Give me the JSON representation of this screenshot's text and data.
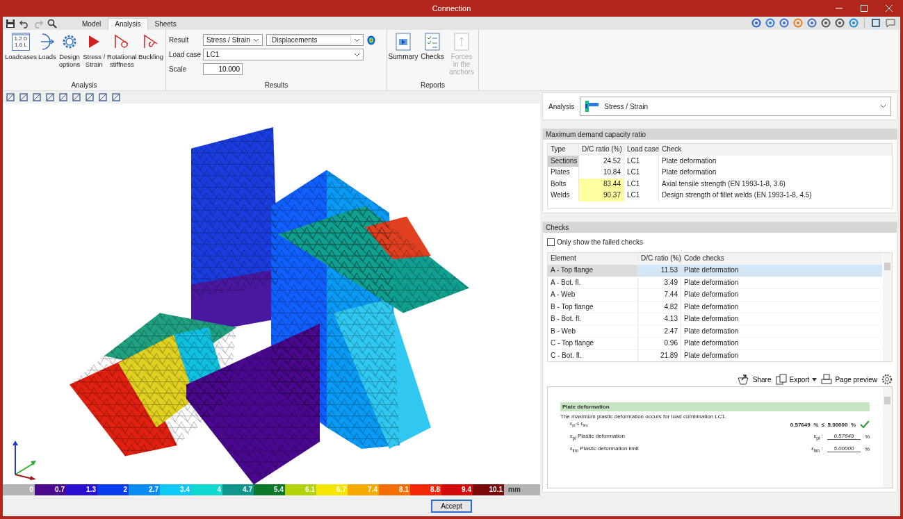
{
  "window": {
    "title": "Connection"
  },
  "tabs": [
    {
      "label": "Model",
      "selected": false
    },
    {
      "label": "Analysis",
      "selected": true
    },
    {
      "label": "Sheets",
      "selected": false
    }
  ],
  "ribbon": {
    "groups": [
      {
        "label": "Analysis",
        "buttons": [
          {
            "kind": "loadcases",
            "label": "Loadcases",
            "disabled": false,
            "icon_text": [
              "1.2 D",
              "1.6 L"
            ]
          },
          {
            "kind": "loads",
            "label": "Loads",
            "disabled": false
          },
          {
            "kind": "gear",
            "label": "Design options",
            "disabled": false
          },
          {
            "kind": "play",
            "label": "Stress / Strain",
            "disabled": false
          },
          {
            "kind": "rotation",
            "label": "Rotational stiffness",
            "disabled": false
          },
          {
            "kind": "buckling",
            "label": "Buckling",
            "disabled": false
          }
        ]
      },
      {
        "label": "Results",
        "fields": {
          "result_label": "Result",
          "result_type": "Stress / Strain",
          "result_value": "Displacements",
          "load_case_label": "Load case",
          "load_case": "LC1",
          "scale_label": "Scale",
          "scale": "10.000"
        }
      },
      {
        "label": "Reports",
        "buttons": [
          {
            "kind": "summary",
            "label": "Summary",
            "disabled": false
          },
          {
            "kind": "checks",
            "label": "Checks",
            "disabled": false
          },
          {
            "kind": "anchors",
            "label": "Forces in the anchors",
            "disabled": true
          }
        ]
      }
    ]
  },
  "legend": {
    "unit": "mm",
    "stops": [
      {
        "label": "0",
        "color": "#b4b4b4"
      },
      {
        "label": "0.7",
        "color": "#4b0a8c"
      },
      {
        "label": "1.3",
        "color": "#2a10d0"
      },
      {
        "label": "2",
        "color": "#0a3cf0"
      },
      {
        "label": "2.7",
        "color": "#0a8cf5"
      },
      {
        "label": "3.4",
        "color": "#10c8f5"
      },
      {
        "label": "4",
        "color": "#10d8d0"
      },
      {
        "label": "4.7",
        "color": "#10968c"
      },
      {
        "label": "5.4",
        "color": "#0a7828"
      },
      {
        "label": "6.1",
        "color": "#b4d20a"
      },
      {
        "label": "6.7",
        "color": "#f5e600"
      },
      {
        "label": "7.4",
        "color": "#f5aa00"
      },
      {
        "label": "8.1",
        "color": "#f56e00"
      },
      {
        "label": "8.8",
        "color": "#f02808"
      },
      {
        "label": "9.4",
        "color": "#d20a0a"
      },
      {
        "label": "10.1",
        "color": "#7a0808"
      }
    ]
  },
  "analysis": {
    "label": "Analysis",
    "value": "Stress / Strain"
  },
  "demand": {
    "title": "Maximum demand capacity ratio",
    "columns": [
      "Type",
      "D/C ratio (%)",
      "Load case",
      "Check"
    ],
    "rows": [
      {
        "type": "Sections",
        "ratio": "24.52",
        "load_case": "LC1",
        "check": "Plate deformation",
        "selected": true,
        "warning": false
      },
      {
        "type": "Plates",
        "ratio": "10.84",
        "load_case": "LC1",
        "check": "Plate deformation",
        "selected": false,
        "warning": false
      },
      {
        "type": "Bolts",
        "ratio": "83.44",
        "load_case": "LC1",
        "check": "Axial tensile strength (EN 1993-1-8, 3.6)",
        "selected": false,
        "warning": true
      },
      {
        "type": "Welds",
        "ratio": "90.37",
        "load_case": "LC1",
        "check": "Design strength of fillet welds (EN 1993-1-8, 4.5)",
        "selected": false,
        "warning": true
      }
    ]
  },
  "checks": {
    "title": "Checks",
    "filter": {
      "label": "Only show the failed checks",
      "checked": false
    },
    "columns": [
      "Element",
      "D/C ratio (%)",
      "Code checks"
    ],
    "rows": [
      {
        "element": "A - Top flange",
        "ratio": "11.53",
        "check": "Plate deformation",
        "selected": true
      },
      {
        "element": "A - Bot. fl.",
        "ratio": "3.49",
        "check": "Plate deformation",
        "selected": false
      },
      {
        "element": "A - Web",
        "ratio": "7.44",
        "check": "Plate deformation",
        "selected": false
      },
      {
        "element": "B - Top flange",
        "ratio": "4.82",
        "check": "Plate deformation",
        "selected": false
      },
      {
        "element": "B - Bot. fl.",
        "ratio": "4.13",
        "check": "Plate deformation",
        "selected": false
      },
      {
        "element": "B - Web",
        "ratio": "2.47",
        "check": "Plate deformation",
        "selected": false
      },
      {
        "element": "C - Top flange",
        "ratio": "0.96",
        "check": "Plate deformation",
        "selected": false
      },
      {
        "element": "C - Bot. fl.",
        "ratio": "21.89",
        "check": "Plate deformation",
        "selected": false
      }
    ],
    "actions": [
      "Share",
      "Export",
      "Page preview"
    ]
  },
  "report": {
    "title": "Plate deformation",
    "sentence": "The maximum plastic deformation occurs for load combination LC1.",
    "condition": "ε$_{pl}$ ≤ ε$_{lim}$",
    "result": "0.57649  %  ≤  5.00000  %",
    "passed": true,
    "rows": [
      {
        "symbol": "ε$_{pl}$",
        "label": "Plastic deformation",
        "key": "ε$_{pl}$ :",
        "value": "0.57649",
        "unit": "%"
      },
      {
        "symbol": "ε$_{lim}$",
        "label": "Plastic deformation limit",
        "key": "ε$_{lim}$ :",
        "value": "5.00000",
        "unit": "%"
      }
    ]
  },
  "footer": {
    "accept": "Accept"
  }
}
